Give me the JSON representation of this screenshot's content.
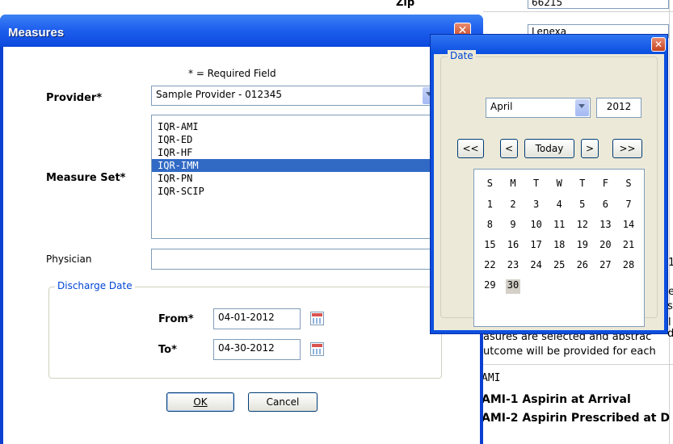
{
  "background": {
    "zip_label": "Zip",
    "zip_value": "66215",
    "city_value": "Lenexa",
    "partial_text_1": "e",
    "partial_text_2": "si",
    "partial_text_3": "l",
    "partial_text_4": "d",
    "info_line_1": "asures are selected and abstrac",
    "info_line_2": "utcome will be provided for each",
    "side_fragment": "1",
    "ami_label": "AMI",
    "measure_1": "AMI-1 Aspirin at Arrival",
    "measure_2": "AMI-2 Aspirin Prescribed at D"
  },
  "measures_dialog": {
    "title": "Measures",
    "required_note": "* = Required Field",
    "provider_label": "Provider*",
    "provider_value": "Sample Provider - 012345",
    "measure_set_label": "Measure Set*",
    "measure_sets": [
      {
        "label": "IQR-AMI",
        "selected": false
      },
      {
        "label": "IQR-ED",
        "selected": false
      },
      {
        "label": "IQR-HF",
        "selected": false
      },
      {
        "label": "IQR-IMM",
        "selected": true
      },
      {
        "label": "IQR-PN",
        "selected": false
      },
      {
        "label": "IQR-SCIP",
        "selected": false
      }
    ],
    "physician_label": "Physician",
    "physician_value": "",
    "discharge_legend": "Discharge Date",
    "from_label": "From*",
    "from_value": "04-01-2012",
    "to_label": "To*",
    "to_value": "04-30-2012",
    "ok_label": "OK",
    "cancel_label": "Cancel"
  },
  "date_picker": {
    "group_legend": "Date",
    "month": "April",
    "year": "2012",
    "nav": {
      "prev_year": "<<",
      "prev_month": "<",
      "today": "Today",
      "next_month": ">",
      "next_year": ">>"
    },
    "weekdays": [
      "S",
      "M",
      "T",
      "W",
      "T",
      "F",
      "S"
    ],
    "weeks": [
      [
        "1",
        "2",
        "3",
        "4",
        "5",
        "6",
        "7"
      ],
      [
        "8",
        "9",
        "10",
        "11",
        "12",
        "13",
        "14"
      ],
      [
        "15",
        "16",
        "17",
        "18",
        "19",
        "20",
        "21"
      ],
      [
        "22",
        "23",
        "24",
        "25",
        "26",
        "27",
        "28"
      ],
      [
        "29",
        "30",
        "",
        "",
        "",
        "",
        ""
      ]
    ],
    "highlighted_day": "30"
  },
  "colors": {
    "title_bar": "#0a48dd",
    "selection": "#316ac5",
    "legend_text": "#0046d5",
    "close_button": "#c5431f"
  },
  "icons": [
    "close-icon",
    "calendar-icon",
    "dropdown-arrow-icon"
  ]
}
